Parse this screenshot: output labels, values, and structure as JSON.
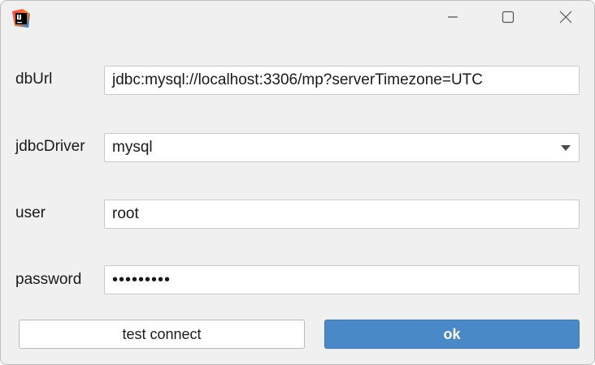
{
  "window": {
    "app_icon": "intellij-idea-icon",
    "controls": {
      "minimize": "minimize-icon",
      "maximize": "maximize-icon",
      "close": "close-icon"
    }
  },
  "form": {
    "db_url": {
      "label": "dbUrl",
      "value": "jdbc:mysql://localhost:3306/mp?serverTimezone=UTC"
    },
    "jdbc_driver": {
      "label": "jdbcDriver",
      "selected": "mysql"
    },
    "user": {
      "label": "user",
      "value": "root"
    },
    "password": {
      "label": "password",
      "masked_value": "•••••••••"
    }
  },
  "buttons": {
    "test_connect": "test connect",
    "ok": "ok"
  },
  "colors": {
    "window_bg": "#f0f0f0",
    "ok_button_bg": "#4a89c8",
    "field_bg": "#ffffff"
  }
}
